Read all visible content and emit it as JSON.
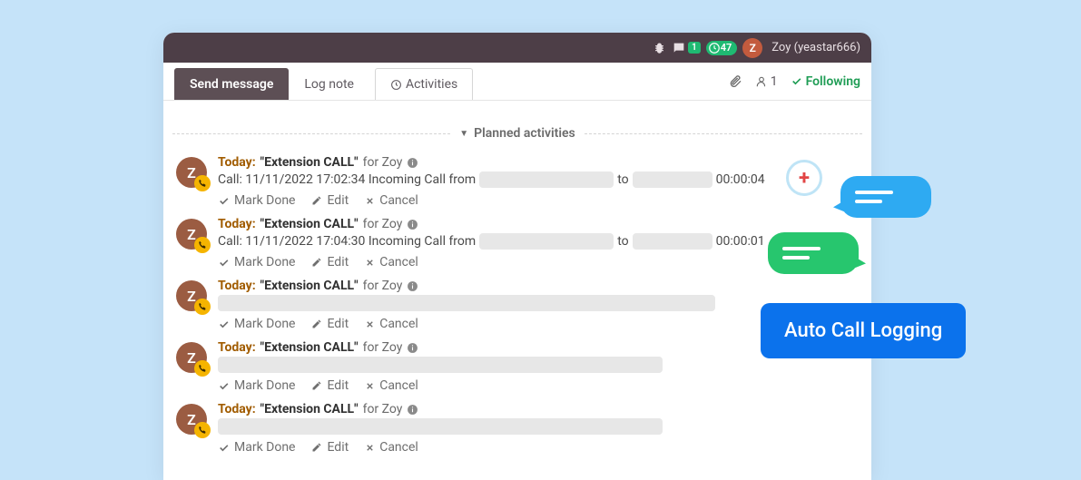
{
  "topbar": {
    "chat_badge": "1",
    "clock_badge": "47",
    "avatar_letter": "Z",
    "user_display": "Zoy (yeastar666)"
  },
  "tabs": {
    "send_message": "Send message",
    "log_note": "Log note",
    "activities": "Activities"
  },
  "right": {
    "follower_count": "1",
    "following": "Following"
  },
  "section": {
    "planned": "Planned activities"
  },
  "common": {
    "today": "Today:",
    "quoted": "\"Extension CALL\"",
    "for": "for Zoy",
    "mark_done": "Mark Done",
    "edit": "Edit",
    "cancel": "Cancel",
    "avatar_letter": "Z",
    "to": "to"
  },
  "activities": [
    {
      "detail_prefix": "Call: 11/11/2022 17:02:34 Incoming Call from",
      "redact1_w": 148,
      "redact2_w": 88,
      "duration": "00:00:04",
      "show_detail": true
    },
    {
      "detail_prefix": "Call: 11/11/2022 17:04:30 Incoming Call from",
      "redact1_w": 148,
      "redact2_w": 88,
      "duration": "00:00:01",
      "show_detail": true
    },
    {
      "full_redact_w": 548,
      "show_detail": false
    },
    {
      "full_redact_w": 490,
      "show_detail": false
    },
    {
      "full_redact_w": 490,
      "show_detail": false
    }
  ],
  "callout": "Auto Call Logging"
}
